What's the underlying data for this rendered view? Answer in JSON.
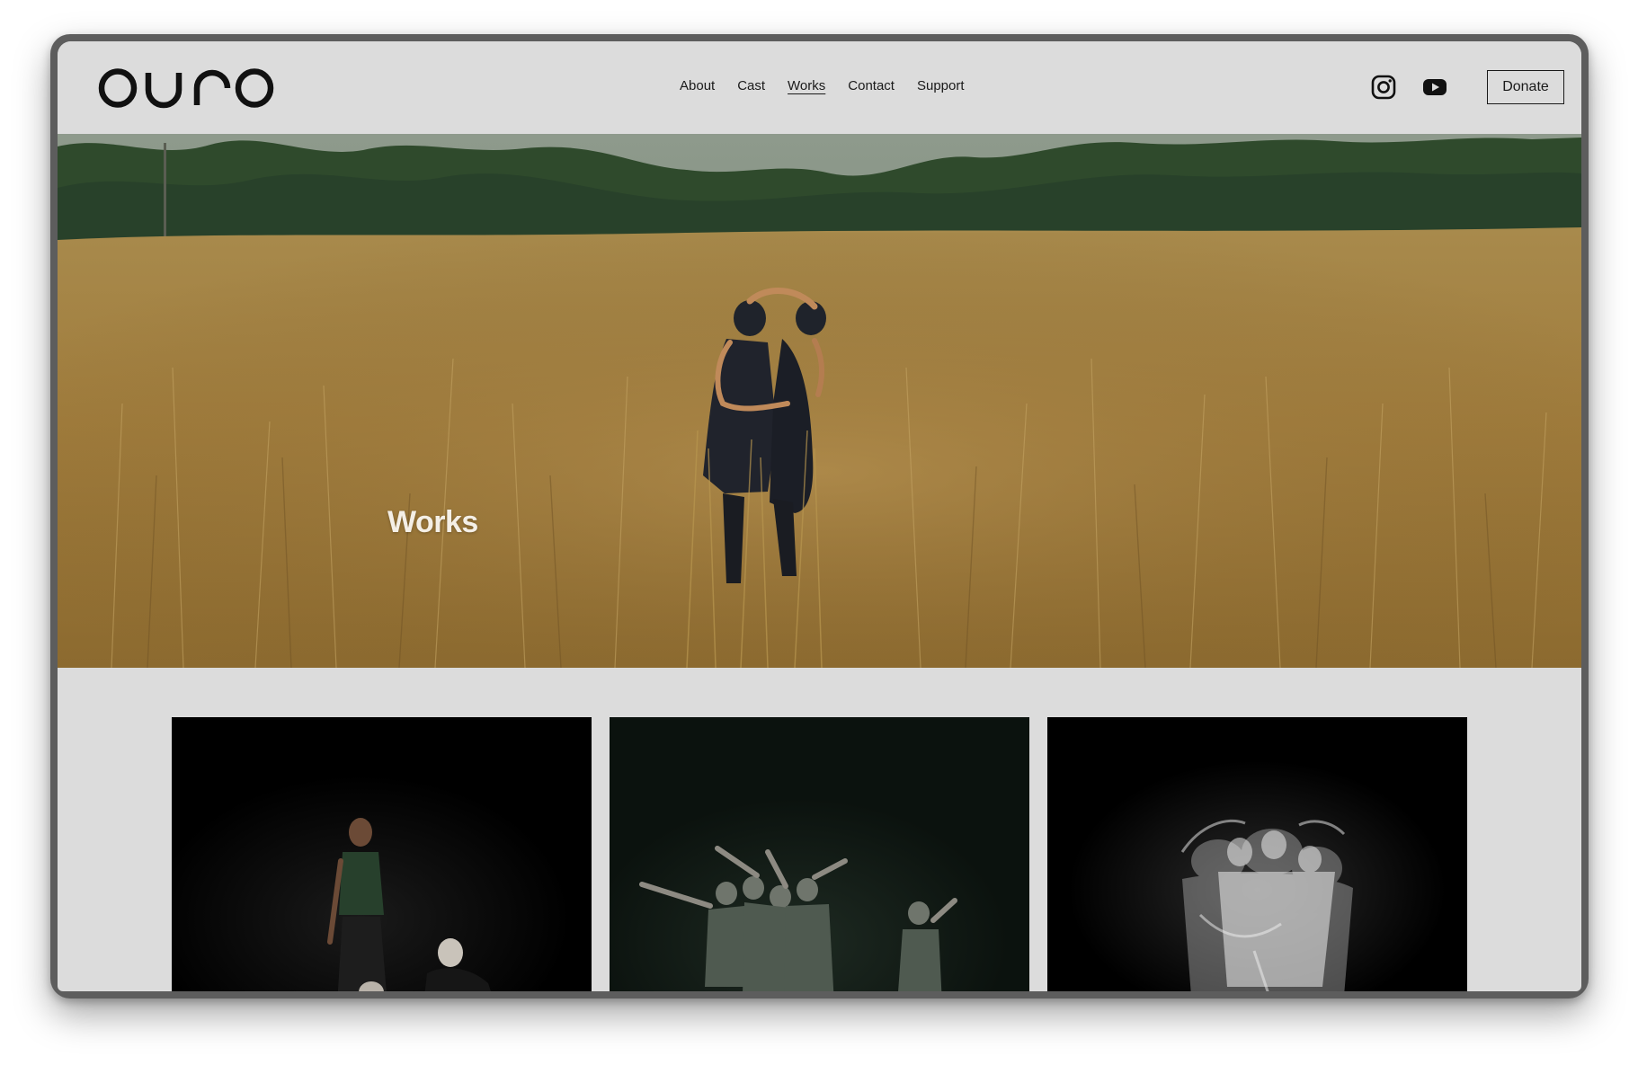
{
  "brand": {
    "logo_text": "ouro"
  },
  "nav": {
    "items": [
      {
        "label": "About",
        "active": false
      },
      {
        "label": "Cast",
        "active": false
      },
      {
        "label": "Works",
        "active": true
      },
      {
        "label": "Contact",
        "active": false
      },
      {
        "label": "Support",
        "active": false
      }
    ]
  },
  "social": {
    "icons": [
      "instagram-icon",
      "youtube-icon"
    ]
  },
  "header": {
    "donate_label": "Donate"
  },
  "hero": {
    "title": "Works"
  },
  "colors": {
    "page_background": "#dcdcdc",
    "text": "#1a1a1a",
    "hero_grass": "#a07c3c",
    "hero_trees": "#2f4a2c",
    "card_background": "#000000"
  },
  "works": {
    "cards": [
      {
        "image": "dancers-in-spotlight-photo"
      },
      {
        "image": "dancers-reaching-dark-stage-photo"
      },
      {
        "image": "motion-blur-dancers-photo"
      }
    ]
  }
}
